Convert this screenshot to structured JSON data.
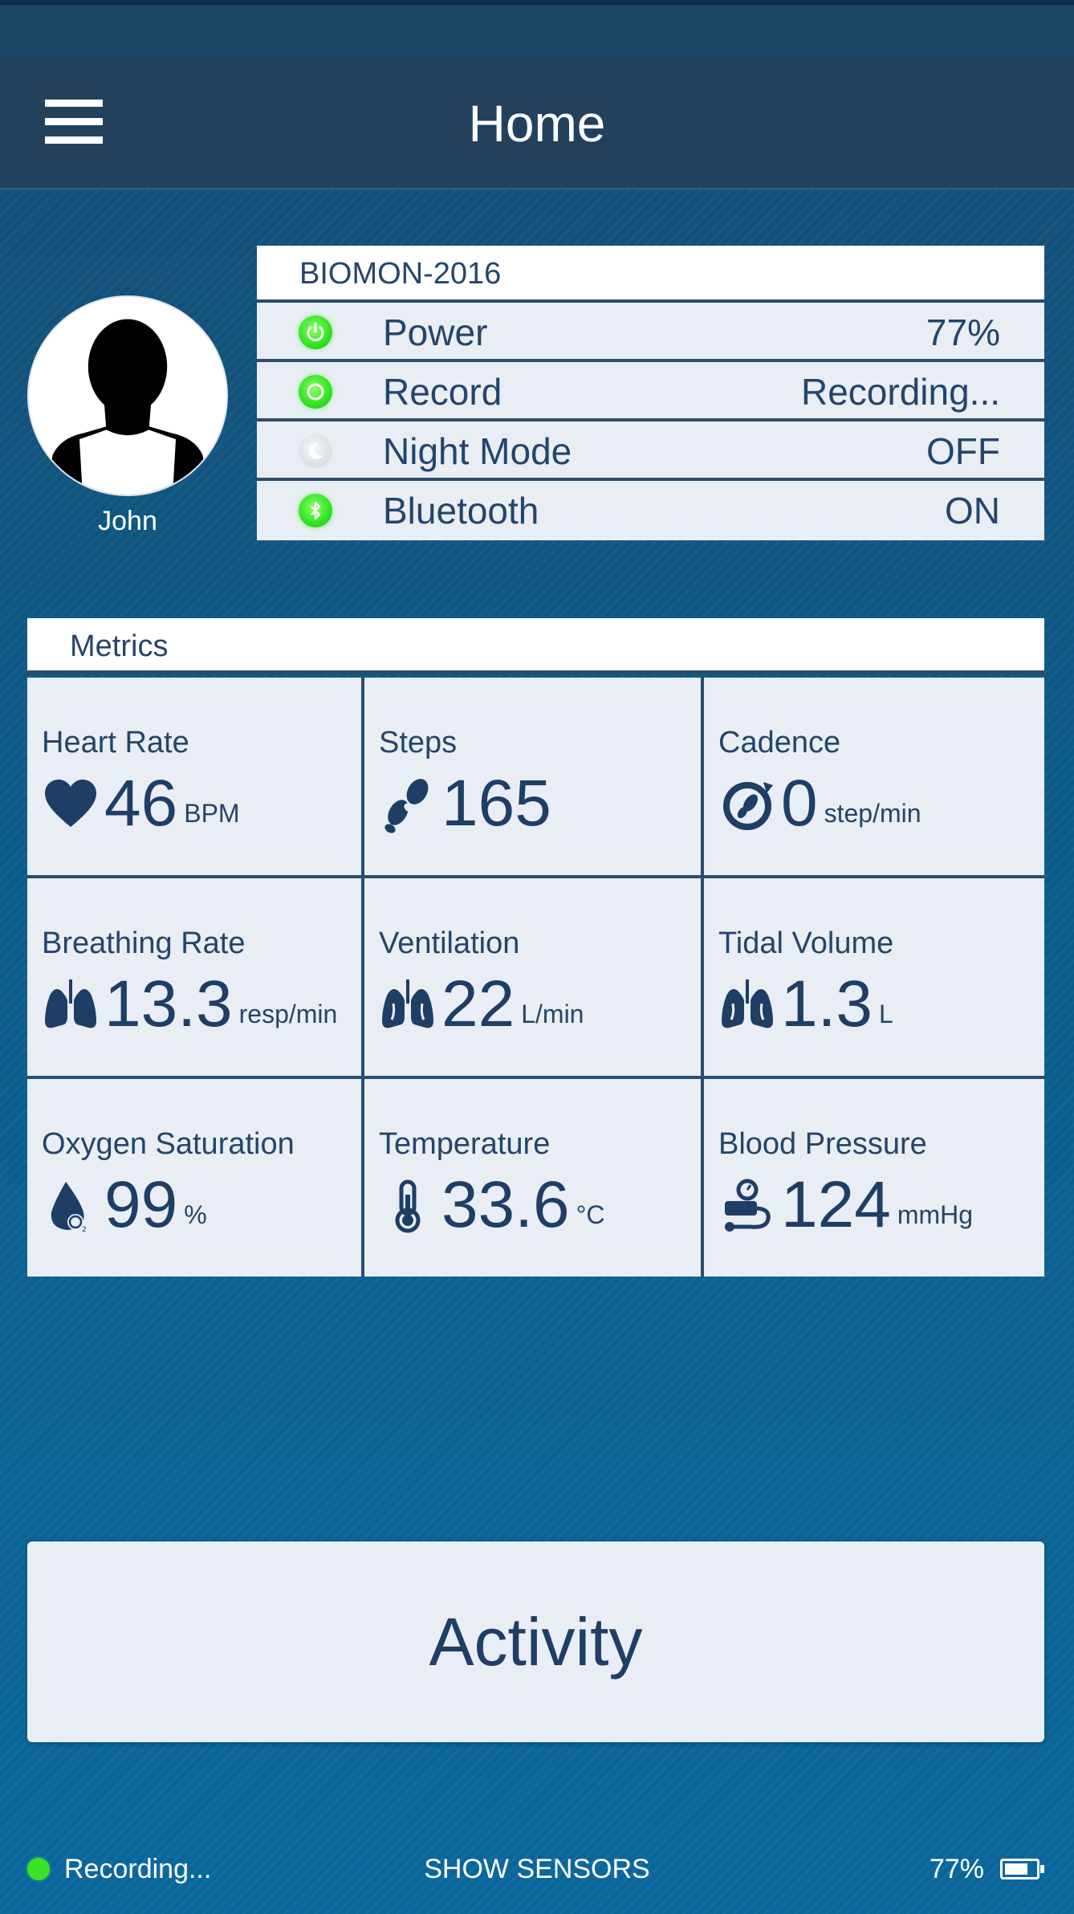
{
  "header": {
    "title": "Home"
  },
  "profile": {
    "name": "John"
  },
  "device": {
    "name": "BIOMON-2016",
    "rows": [
      {
        "label": "Power",
        "value": "77%",
        "state": "on",
        "icon": "power-icon"
      },
      {
        "label": "Record",
        "value": "Recording...",
        "state": "on",
        "icon": "record-icon"
      },
      {
        "label": "Night Mode",
        "value": "OFF",
        "state": "off",
        "icon": "moon-icon"
      },
      {
        "label": "Bluetooth",
        "value": "ON",
        "state": "on",
        "icon": "bluetooth-icon"
      }
    ]
  },
  "metrics": {
    "title": "Metrics",
    "items": [
      {
        "label": "Heart Rate",
        "value": "46",
        "unit": "BPM",
        "icon": "heart-icon"
      },
      {
        "label": "Steps",
        "value": "165",
        "unit": "",
        "icon": "footsteps-icon"
      },
      {
        "label": "Cadence",
        "value": "0",
        "unit": "step/min",
        "icon": "cadence-icon"
      },
      {
        "label": "Breathing Rate",
        "value": "13.3",
        "unit": "resp/min",
        "icon": "lungs-icon"
      },
      {
        "label": "Ventilation",
        "value": "22",
        "unit": "L/min",
        "icon": "lungs-icon"
      },
      {
        "label": "Tidal Volume",
        "value": "1.3",
        "unit": "L",
        "icon": "lungs-icon"
      },
      {
        "label": "Oxygen Saturation",
        "value": "99",
        "unit": "%",
        "icon": "oxygen-drop-icon"
      },
      {
        "label": "Temperature",
        "value": "33.6",
        "unit": "°C",
        "icon": "thermometer-icon"
      },
      {
        "label": "Blood Pressure",
        "value": "124",
        "unit": "mmHg",
        "icon": "blood-pressure-icon"
      }
    ]
  },
  "activity": {
    "label": "Activity"
  },
  "footer": {
    "recording": "Recording...",
    "show_sensors": "SHOW SENSORS",
    "battery": "77%"
  },
  "colors": {
    "accent_green": "#3ae22a",
    "nav_bg": "#23415d",
    "text_dark": "#1f3e66"
  }
}
